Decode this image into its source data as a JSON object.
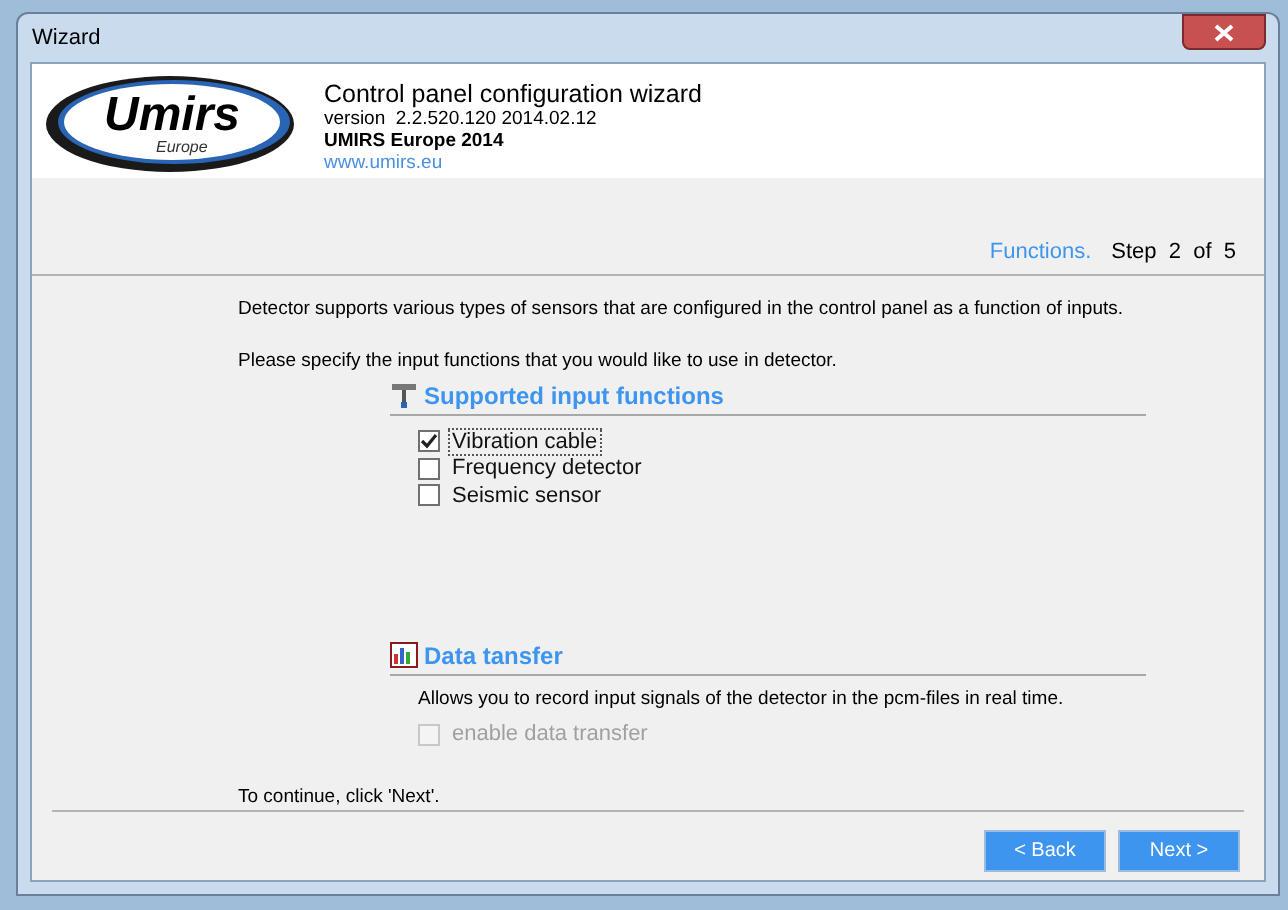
{
  "window": {
    "title": "Wizard"
  },
  "header": {
    "logo_text": "Umirs",
    "logo_subtext": "Europe",
    "title": "Control panel configuration wizard",
    "version": "version  2.2.520.120 2014.02.12",
    "company": "UMIRS Europe 2014",
    "link": "www.umirs.eu"
  },
  "step": {
    "name": "Functions.",
    "counter": "Step  2  of  5"
  },
  "intro": "Detector supports various types of sensors that are configured in the control panel as a function of inputs.",
  "prompt": "Please specify the input functions that you would like to use in detector.",
  "input_functions": {
    "heading": "Supported input functions",
    "options": [
      {
        "label": "Vibration cable",
        "checked": true,
        "focused": true,
        "disabled": false
      },
      {
        "label": "Frequency detector",
        "checked": false,
        "focused": false,
        "disabled": false
      },
      {
        "label": "Seismic sensor",
        "checked": false,
        "focused": false,
        "disabled": false
      }
    ]
  },
  "data_transfer": {
    "heading": "Data tansfer",
    "description": "Allows you to record input signals of the detector in the pcm-files in real time.",
    "options": [
      {
        "label": "enable data transfer",
        "checked": false,
        "focused": false,
        "disabled": true
      }
    ]
  },
  "footer_hint": "To continue, click 'Next'.",
  "buttons": [
    {
      "label": "< Back"
    },
    {
      "label": "Next >"
    }
  ]
}
